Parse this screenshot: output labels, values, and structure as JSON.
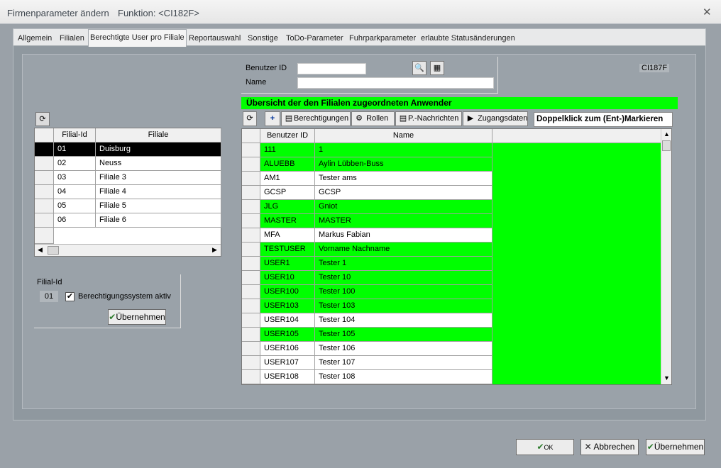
{
  "window": {
    "title": "Firmenparameter ändern",
    "function_label": "Funktion: <CI182F>"
  },
  "tabs": [
    {
      "label": "Allgemein",
      "active": false
    },
    {
      "label": "Filialen",
      "active": false
    },
    {
      "label": "Berechtigte User pro Filiale",
      "active": true
    },
    {
      "label": "Reportauswahl",
      "active": false
    },
    {
      "label": "Sonstige",
      "active": false
    },
    {
      "label": "ToDo-Parameter",
      "active": false
    },
    {
      "label": "Fuhrparkparameter",
      "active": false
    },
    {
      "label": "erlaubte Statusänderungen",
      "active": false
    }
  ],
  "form": {
    "benutzer_id_label": "Benutzer ID",
    "benutzer_id_value": "",
    "name_label": "Name",
    "name_value": "",
    "code_label": "CI187F"
  },
  "filial_grid": {
    "headers": [
      "Filial-Id",
      "Filiale"
    ],
    "rows": [
      {
        "id": "01",
        "name": "Duisburg",
        "selected": true
      },
      {
        "id": "02",
        "name": "Neuss",
        "selected": false
      },
      {
        "id": "03",
        "name": "Filiale 3",
        "selected": false
      },
      {
        "id": "04",
        "name": "Filiale 4",
        "selected": false
      },
      {
        "id": "05",
        "name": "Filiale 5",
        "selected": false
      },
      {
        "id": "06",
        "name": "Filiale 6",
        "selected": false
      }
    ]
  },
  "filial_detail": {
    "id_label": "Filial-Id",
    "id_value": "01",
    "checkbox_label": "Berechtigungssystem aktiv",
    "checkbox_checked": true,
    "apply_button": "Übernehmen"
  },
  "user_panel": {
    "title": "Übersicht der den Filialen zugeordneten Anwender",
    "toolbar": {
      "berechtigungen": "Berechtigungen",
      "rollen": "Rollen",
      "nachrichten": "P.-Nachrichten",
      "zugangsdaten": "Zugangsdaten"
    },
    "hint": "Doppelklick zum (Ent-)Markieren",
    "headers": [
      "Benutzer ID",
      "Name"
    ],
    "rows": [
      {
        "id": "111",
        "name": "1",
        "marked": true
      },
      {
        "id": "ALUEBB",
        "name": "Aylin Lübben-Buss",
        "marked": true
      },
      {
        "id": "AM1",
        "name": "Tester ams",
        "marked": false
      },
      {
        "id": "GCSP",
        "name": "GCSP",
        "marked": false
      },
      {
        "id": "JLG",
        "name": "Gniot",
        "marked": true
      },
      {
        "id": "MASTER",
        "name": "MASTER",
        "marked": true
      },
      {
        "id": "MFA",
        "name": "Markus Fabian",
        "marked": false
      },
      {
        "id": "TESTUSER",
        "name": "Vorname Nachname",
        "marked": true
      },
      {
        "id": "USER1",
        "name": "Tester 1",
        "marked": true
      },
      {
        "id": "USER10",
        "name": "Tester 10",
        "marked": true
      },
      {
        "id": "USER100",
        "name": "Tester 100",
        "marked": true
      },
      {
        "id": "USER103",
        "name": "Tester 103",
        "marked": true
      },
      {
        "id": "USER104",
        "name": "Tester 104",
        "marked": false
      },
      {
        "id": "USER105",
        "name": "Tester 105",
        "marked": true
      },
      {
        "id": "USER106",
        "name": "Tester 106",
        "marked": false
      },
      {
        "id": "USER107",
        "name": "Tester 107",
        "marked": false
      },
      {
        "id": "USER108",
        "name": "Tester 108",
        "marked": false
      }
    ]
  },
  "footer": {
    "ok": "OK",
    "abbrechen": "Abbrechen",
    "uebernehmen": "Übernehmen"
  },
  "colors": {
    "marked_green": "#00ff00",
    "panel_gray": "#9aa2a9"
  }
}
